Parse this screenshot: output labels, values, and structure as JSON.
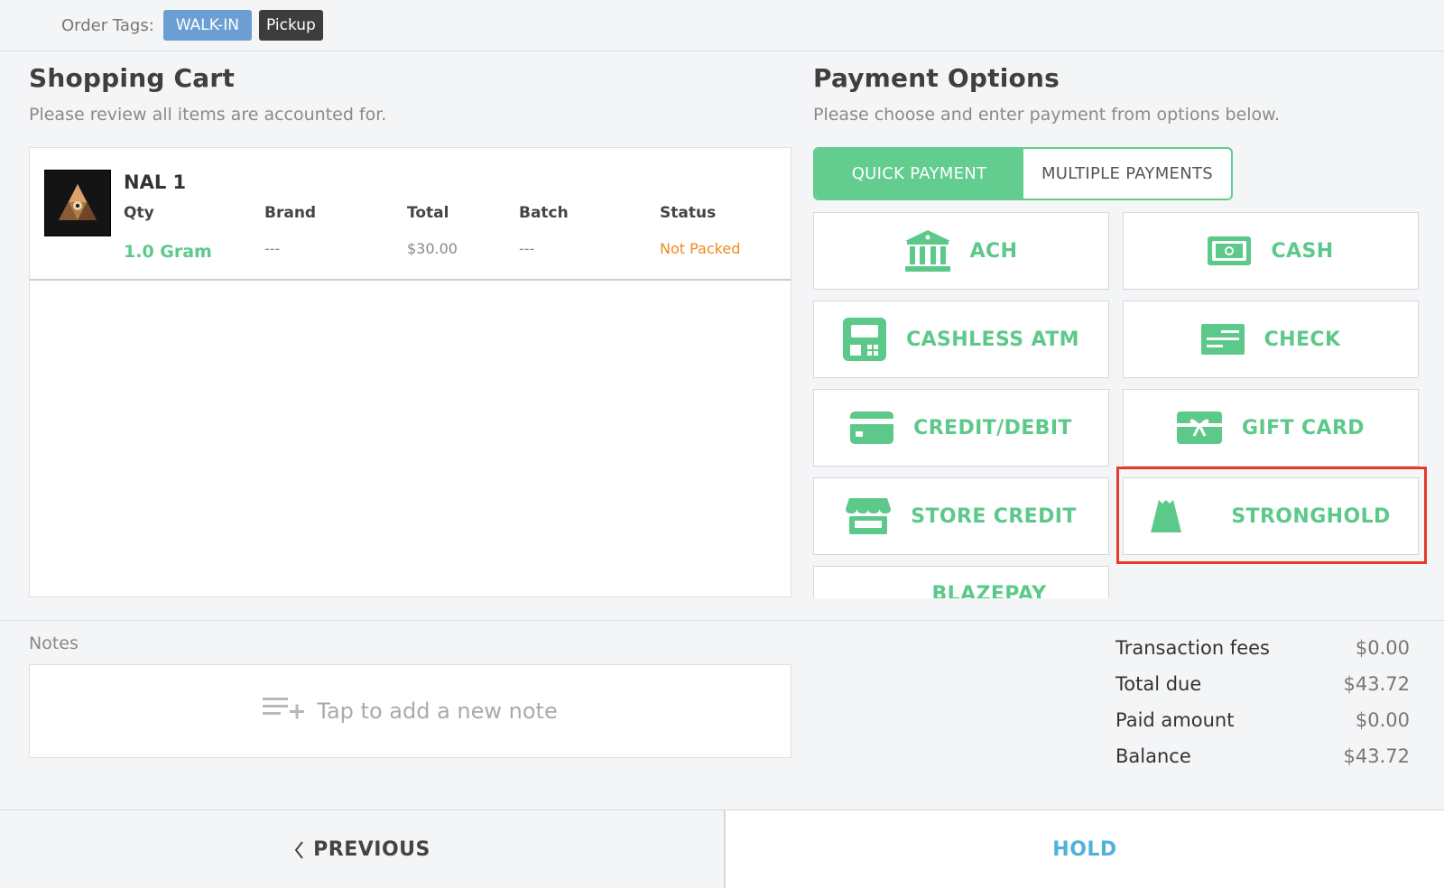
{
  "order_tags": {
    "label": "Order Tags:",
    "tags": [
      "WALK-IN",
      "Pickup"
    ]
  },
  "cart": {
    "title": "Shopping Cart",
    "subtitle": "Please review all items are accounted for.",
    "columns": [
      "Qty",
      "Brand",
      "Total",
      "Batch",
      "Status"
    ],
    "items": [
      {
        "image_icon": "product-thumbnail",
        "name": "NAL 1",
        "qty": "1.0 Gram",
        "brand": "---",
        "total": "$30.00",
        "batch": "---",
        "status": "Not Packed"
      }
    ]
  },
  "payment": {
    "title": "Payment Options",
    "subtitle": "Please choose and enter payment from options below.",
    "modes": [
      "QUICK PAYMENT",
      "MULTIPLE PAYMENTS"
    ],
    "active_mode": "QUICK PAYMENT",
    "options": [
      {
        "label": "ACH",
        "icon": "bank-icon"
      },
      {
        "label": "CASH",
        "icon": "cash-icon"
      },
      {
        "label": "CASHLESS ATM",
        "icon": "atm-icon"
      },
      {
        "label": "CHECK",
        "icon": "check-icon"
      },
      {
        "label": "CREDIT/DEBIT",
        "icon": "credit-card-icon"
      },
      {
        "label": "GIFT CARD",
        "icon": "gift-card-icon"
      },
      {
        "label": "STORE CREDIT",
        "icon": "store-icon"
      },
      {
        "label": "STRONGHOLD",
        "icon": "stronghold-icon"
      },
      {
        "label": "BLAZEPAY",
        "icon": "blazepay-icon"
      }
    ],
    "highlighted_option": "STRONGHOLD"
  },
  "notes": {
    "label": "Notes",
    "placeholder": "Tap to add a new note"
  },
  "totals": [
    {
      "label": "Transaction fees",
      "value": "$0.00"
    },
    {
      "label": "Total due",
      "value": "$43.72"
    },
    {
      "label": "Paid amount",
      "value": "$0.00"
    },
    {
      "label": "Balance",
      "value": "$43.72"
    }
  ],
  "footer": {
    "previous_label": "PREVIOUS",
    "hold_label": "HOLD"
  },
  "colors": {
    "accent_green": "#63cc8f",
    "walkin_blue": "#6b9fd4",
    "status_orange": "#ef8a1e",
    "hold_blue": "#4fb3d9",
    "highlight_red": "#e53b2c"
  }
}
